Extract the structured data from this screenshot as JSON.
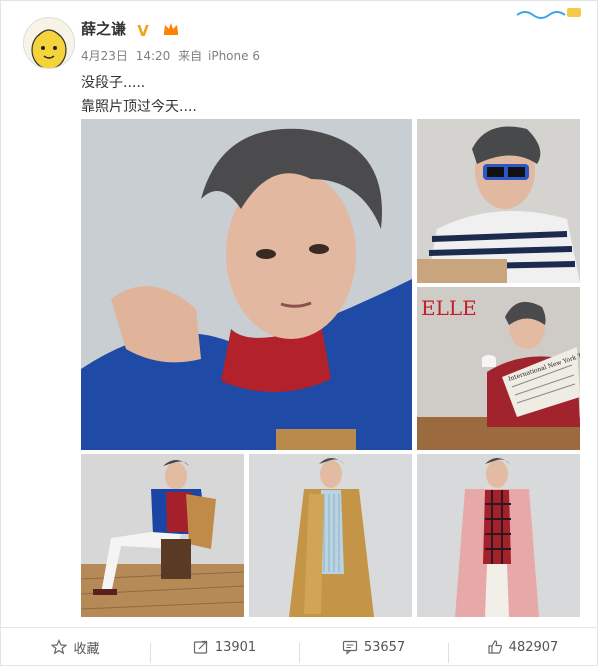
{
  "post": {
    "author": "薛之谦",
    "date": "4月23日",
    "time": "14:20",
    "source_prefix": "来自",
    "device": "iPhone 6",
    "lines": [
      "没段子.....",
      "靠照片顶过今天...."
    ]
  },
  "magazine_logo": "ELLE",
  "newspaper_title": "International New York Times",
  "actions": {
    "favorite": "收藏",
    "repost": "13901",
    "comment": "53657",
    "like": "482907"
  },
  "icons": [
    "verified-icon",
    "member-crown-icon",
    "star-icon",
    "repost-icon",
    "comment-icon",
    "like-icon"
  ],
  "colors": {
    "verified": "#f2a317",
    "brand_orange": "#ff8200",
    "text": "#333333",
    "meta": "#808080"
  }
}
